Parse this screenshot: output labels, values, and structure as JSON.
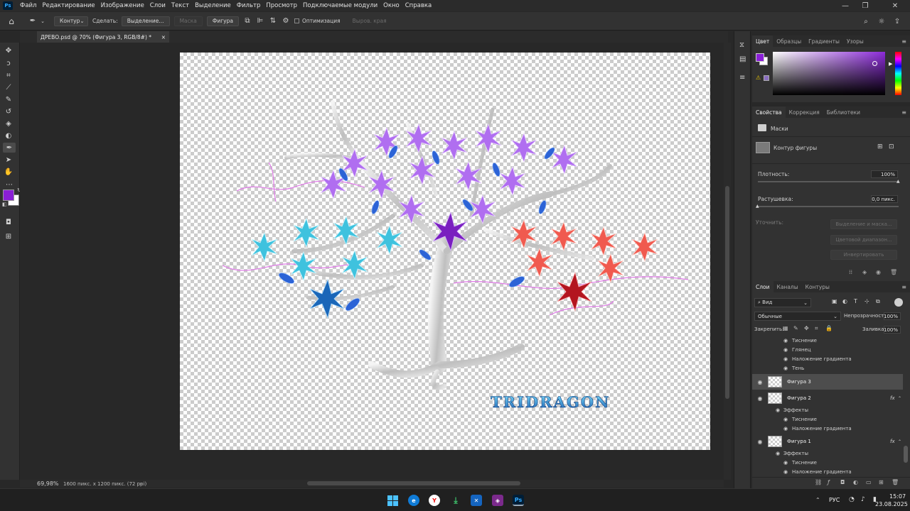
{
  "app": {
    "logo": "Ps",
    "menu": [
      "Файл",
      "Редактирование",
      "Изображение",
      "Слои",
      "Текст",
      "Выделение",
      "Фильтр",
      "Просмотр",
      "Подключаемые модули",
      "Окно",
      "Справка"
    ],
    "window_controls": {
      "minimize": "—",
      "maximize": "❐",
      "close": "✕"
    }
  },
  "options_bar": {
    "mode_value": "Контур",
    "make_label": "Сделать:",
    "selection_btn": "Выделение...",
    "mask_btn": "Маска",
    "shape_btn": "Фигура",
    "optimize_label": "Оптимизация",
    "align_edges_label": "Выров. края"
  },
  "document": {
    "tab_title": "ДРЕВО.psd @ 70% (Фигура 3, RGB/8#) *",
    "tab_close": "×",
    "zoom": "69,98%",
    "dimensions": "1600 пикс. x 1200 пикс. (72 ppi)",
    "watermark": "TRIDRAGON"
  },
  "colors": {
    "foreground": "#8a1fd6",
    "background": "#ffffff",
    "accent_purple": "#8b2be2",
    "tree_silver": "#c8c8c8"
  },
  "color_panel": {
    "tabs": [
      "Цвет",
      "Образцы",
      "Градиенты",
      "Узоры"
    ],
    "active_tab": "Цвет",
    "hue": "#8c2bd9"
  },
  "properties_panel": {
    "tabs": [
      "Свойства",
      "Коррекция",
      "Библиотеки"
    ],
    "active_tab": "Свойства",
    "masks_label": "Маски",
    "shape_contour_label": "Контур фигуры",
    "density_label": "Плотность:",
    "density_value": "100%",
    "density_fraction": 1.0,
    "feather_label": "Растушевка:",
    "feather_value": "0,0 пикс.",
    "feather_fraction": 0.0,
    "refine_label": "Уточнить:",
    "buttons": [
      "Выделение и маска...",
      "Цветовой диапазон...",
      "Инвертировать"
    ]
  },
  "layers_panel": {
    "tabs": [
      "Слои",
      "Каналы",
      "Контуры"
    ],
    "active_tab": "Слои",
    "filter_label": "Вид",
    "blend_mode": "Обычные",
    "opacity_label": "Непрозрачность:",
    "opacity_value": "100%",
    "lock_label": "Закрепить:",
    "fill_label": "Заливка:",
    "fill_value": "100%",
    "top_effects": [
      "Тиснение",
      "Глянец",
      "Наложение градиента",
      "Тень"
    ],
    "layers": [
      {
        "name": "Фигура 3",
        "selected": true,
        "fx": "",
        "effects_label": "",
        "effects": []
      },
      {
        "name": "Фигура 2",
        "selected": false,
        "fx": "fx",
        "effects_label": "Эффекты",
        "effects": [
          "Тиснение",
          "Наложение градиента"
        ]
      },
      {
        "name": "Фигура 1",
        "selected": false,
        "fx": "fx",
        "effects_label": "Эффекты",
        "effects": [
          "Тиснение",
          "Наложение градиента"
        ]
      }
    ]
  },
  "taskbar": {
    "language": "РУС",
    "time": "15:07",
    "date": "23.08.2025"
  }
}
